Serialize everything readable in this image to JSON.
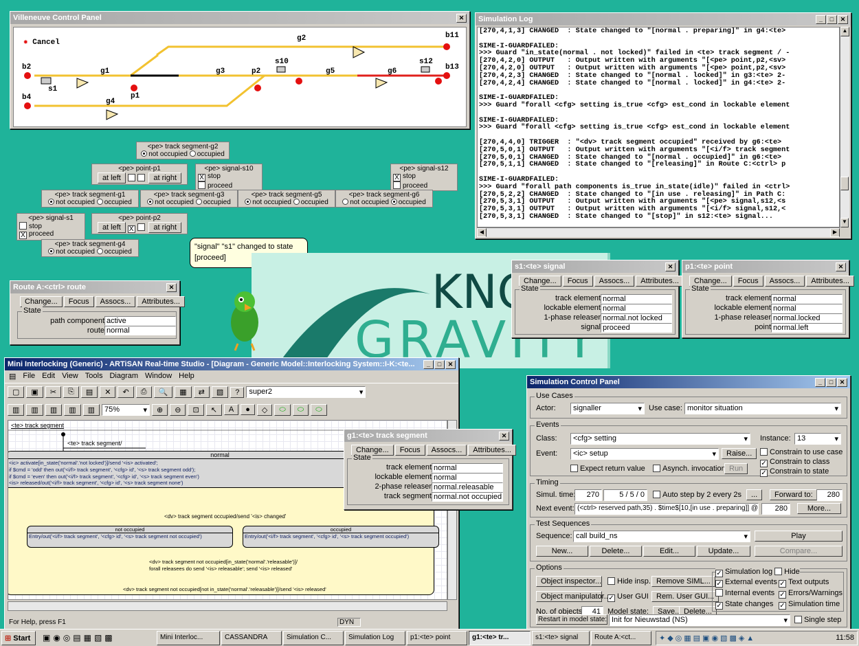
{
  "colors": {
    "desktop": "#1fb39a",
    "track_red": "#e0201c",
    "track_yellow": "#f2c230",
    "signal_red": "#e41010"
  },
  "control_panel": {
    "title": "Villeneuve Control Panel",
    "cancel_label": "Cancel",
    "labels": {
      "g2": "g2",
      "b11": "b11",
      "b2": "b2",
      "s1": "s1",
      "g1": "g1",
      "p1": "p1",
      "g3": "g3",
      "p2": "p2",
      "s10": "s10",
      "g5": "g5",
      "g6": "g6",
      "s12": "s12",
      "b13": "b13",
      "b4": "b4",
      "g4": "g4"
    }
  },
  "pe_panels": {
    "g2": {
      "title": "<pe> track segment-g2",
      "opt1": "not occupied",
      "opt2": "occupied"
    },
    "p1": {
      "title": "<pe> point-p1",
      "left": "at left",
      "right": "at right"
    },
    "s10": {
      "title": "<pe> signal-s10",
      "o1": "stop",
      "o2": "proceed"
    },
    "s12": {
      "title": "<pe> signal-s12",
      "o1": "stop",
      "o2": "proceed"
    },
    "g1": {
      "title": "<pe> track segment-g1",
      "opt1": "not occupied",
      "opt2": "occupied"
    },
    "g3": {
      "title": "<pe> track segment-g3",
      "opt1": "not occupied",
      "opt2": "occupied"
    },
    "g5": {
      "title": "<pe> track segment-g5",
      "opt1": "not occupied",
      "opt2": "occupied"
    },
    "g6": {
      "title": "<pe> track segment-g6",
      "opt1": "not occupied",
      "opt2": "occupied"
    },
    "s1": {
      "title": "<pe> signal-s1",
      "o1": "stop",
      "o2": "proceed"
    },
    "p2": {
      "title": "<pe> point-p2",
      "left": "at left",
      "right": "at right"
    },
    "g4": {
      "title": "<pe> track segment-g4",
      "opt1": "not occupied",
      "opt2": "occupied"
    }
  },
  "speech": {
    "text": "\"signal\" \"s1\" changed to state [proceed]"
  },
  "logo": {
    "line1": "KNO",
    "line2": "GRAVITY"
  },
  "sim_log": {
    "title": "Simulation Log",
    "lines": [
      "[270,4,1,3] CHANGED  : State changed to \"[normal . preparing]\" in g4:<te>",
      "",
      "SIME-I-GUARDFAILED:",
      ">>> Guard \"in_state(normal . not locked)\" failed in <te> track segment / -",
      "[270,4,2,0] OUTPUT   : Output written with arguments \"[<pe> point,p2,<sv>",
      "[270,4,2,0] OUTPUT   : Output written with arguments \"[<pe> point,p2,<sv>",
      "[270,4,2,3] CHANGED  : State changed to \"[normal . locked]\" in g3:<te> 2-",
      "[270,4,2,4] CHANGED  : State changed to \"[normal . locked]\" in g4:<te> 2-",
      "",
      "SIME-I-GUARDFAILED:",
      ">>> Guard \"forall <cfg> setting is_true <cfg> est_cond in lockable element",
      "",
      "SIME-I-GUARDFAILED:",
      ">>> Guard \"forall <cfg> setting is_true <cfg> est_cond in lockable element",
      "",
      "[270,4,4,0] TRIGGER  : \"<dv> track segment occupied\" received by g6:<te>",
      "[270,5,0,1] OUTPUT   : Output written with arguments \"[<i/f> track segment",
      "[270,5,0,1] CHANGED  : State changed to \"[normal . occupied]\" in g6:<te>",
      "[270,5,1,1] CHANGED  : State changed to \"[releasing]\" in Route C:<ctrl> p",
      "",
      "SIME-I-GUARDFAILED:",
      ">>> Guard \"forall path components is_true in_state(idle)\" failed in <ctrl>",
      "[270,5,2,2] CHANGED  : State changed to \"[in use . releasing]\" in Path C:",
      "[270,5,3,1] OUTPUT   : Output written with arguments \"[<pe> signal,s12,<s",
      "[270,5,3,1] OUTPUT   : Output written with arguments \"[<i/f> signal,s12,<",
      "[270,5,3,1] CHANGED  : State changed to \"[stop]\" in s12:<te> signal..."
    ]
  },
  "route_a": {
    "title": "Route A:<ctrl> route",
    "buttons": [
      "Change...",
      "Focus",
      "Assocs...",
      "Attributes..."
    ],
    "state_label": "State",
    "rows": [
      {
        "k": "path component",
        "v": "active"
      },
      {
        "k": "route",
        "v": "normal"
      }
    ]
  },
  "s1_win": {
    "title": "s1:<te> signal",
    "buttons": [
      "Change...",
      "Focus",
      "Assocs...",
      "Attributes..."
    ],
    "state_label": "State",
    "rows": [
      {
        "k": "track element",
        "v": "normal"
      },
      {
        "k": "lockable element",
        "v": "normal"
      },
      {
        "k": "1-phase releaser",
        "v": "normal.not locked"
      },
      {
        "k": "signal",
        "v": "proceed"
      }
    ]
  },
  "p1_win": {
    "title": "p1:<te> point",
    "buttons": [
      "Change...",
      "Focus",
      "Assocs...",
      "Attributes..."
    ],
    "state_label": "State",
    "rows": [
      {
        "k": "track element",
        "v": "normal"
      },
      {
        "k": "lockable element",
        "v": "normal"
      },
      {
        "k": "1-phase releaser",
        "v": "normal.locked"
      },
      {
        "k": "point",
        "v": "normal.left"
      }
    ]
  },
  "g1_win": {
    "title": "g1:<te> track segment",
    "buttons": [
      "Change...",
      "Focus",
      "Assocs...",
      "Attributes..."
    ],
    "state_label": "State",
    "rows": [
      {
        "k": "track element",
        "v": "normal"
      },
      {
        "k": "lockable element",
        "v": "normal"
      },
      {
        "k": "2-phase releaser",
        "v": "normal.releasable"
      },
      {
        "k": "track segment",
        "v": "normal.not occupied"
      }
    ]
  },
  "studio": {
    "title": "Mini Interlocking (Generic) - ARTiSAN Real-time Studio - [Diagram - Generic Model::Interlocking System::I-K:<te...",
    "menu": [
      "File",
      "Edit",
      "View",
      "Tools",
      "Diagram",
      "Window",
      "Help"
    ],
    "combo": "super2",
    "zoom": "75%",
    "status_left": "For Help, press F1",
    "status_dyn": "DYN",
    "diagram": {
      "header": "<te> track segment",
      "sub": "<te> track segment/",
      "normal": "normal",
      "entry_lines": [
        "<ic> activate[in_state('normal'.'not locked')]/send '<is> activated';",
        "  if $cmd = 'odd' then out('<i/f> track segment', '<cfg> id', '<s> track segment odd');",
        "  if $cmd = 'even' then out('<i/f> track segment', '<cfg> id', '<s> track segment even')",
        "<is> released/out('<i/f> track segment', '<cfg> id', '<s> track segment none')"
      ],
      "t_occ": "<dv> track segment occupied/send '<is> changed'",
      "not_occ": "not occupied",
      "not_occ_entry": "Entry/out('<i/f> track segment', '<cfg> id', '<s> track segment not occupied')",
      "occ": "occupied",
      "occ_entry": "Entry/out('<i/f> track segment', '<cfg> id', '<s> track segment occupied')",
      "t_rel1": "<dv> track segment not occupied[in_state('normal'.'releasable')]/",
      "t_rel2": "forall releasees do send '<is> releasable'; send '<is> released'",
      "t_bottom": "<dv> track segment not occupied[not in_state('normal'.'releasable')]/send '<is> released'"
    }
  },
  "scp": {
    "title": "Simulation Control Panel",
    "use_cases": "Use Cases",
    "actor_lbl": "Actor:",
    "actor": "signaller",
    "uc_lbl": "Use case:",
    "uc": "monitor situation",
    "events": "Events",
    "class_lbl": "Class:",
    "class": "<cfg> setting",
    "instance_lbl": "Instance:",
    "instance": "13",
    "event_lbl": "Event:",
    "event": "<ic> setup",
    "raise": "Raise...",
    "c_uc": "Constrain to use case",
    "c_class": "Constrain to class",
    "c_state": "Constrain to state",
    "expect": "Expect return value",
    "async": "Asynch. invocation:",
    "run": "Run",
    "timing": "Timing",
    "simul_lbl": "Simul. time:",
    "simul": "270",
    "simul2": "5 / 5 / 0",
    "autostep": "Auto step by 2 every 2s",
    "ellipsis": "...",
    "forward": "Forward to:",
    "forward_v": "280",
    "next_lbl": "Next event:",
    "next": "(<ctrl> reserved path,35) . $time$[10,[in use . preparing]] @",
    "next_v": "280",
    "more": "More...",
    "seq": "Test Sequences",
    "seq_lbl": "Sequence:",
    "seq_v": "call build_ns",
    "play": "Play",
    "new": "New...",
    "delete": "Delete...",
    "edit": "Edit...",
    "update": "Update...",
    "compare": "Compare...",
    "options": "Options",
    "obj_insp": "Object inspector...",
    "hide_insp": "Hide insp.",
    "remove": "Remove SIML...",
    "obj_man": "Object manipulator...",
    "user_gui": "User GUI",
    "rem_gui": "Rem. User GUI...",
    "nobj_lbl": "No. of objects:",
    "nobj": "41",
    "model_lbl": "Model state:",
    "save": "Save...",
    "del": "Delete...",
    "restart": "Restart in model state:",
    "restart_v": "Init for Nieuwstad (NS)",
    "single": "Single step",
    "simlog": "Simulation log",
    "hide": "Hide",
    "ext": "External events",
    "text_out": "Text outputs",
    "int": "Internal events",
    "errs": "Errors/Warnings",
    "state_ch": "State changes",
    "sim_time": "Simulation time"
  },
  "taskbar": {
    "start": "Start",
    "items": [
      "Mini Interloc...",
      "CASSANDRA",
      "Simulation C...",
      "Simulation Log",
      "p1:<te> point",
      "g1:<te> tr...",
      "s1:<te> signal",
      "Route A:<ct..."
    ],
    "clock": "11:58"
  }
}
